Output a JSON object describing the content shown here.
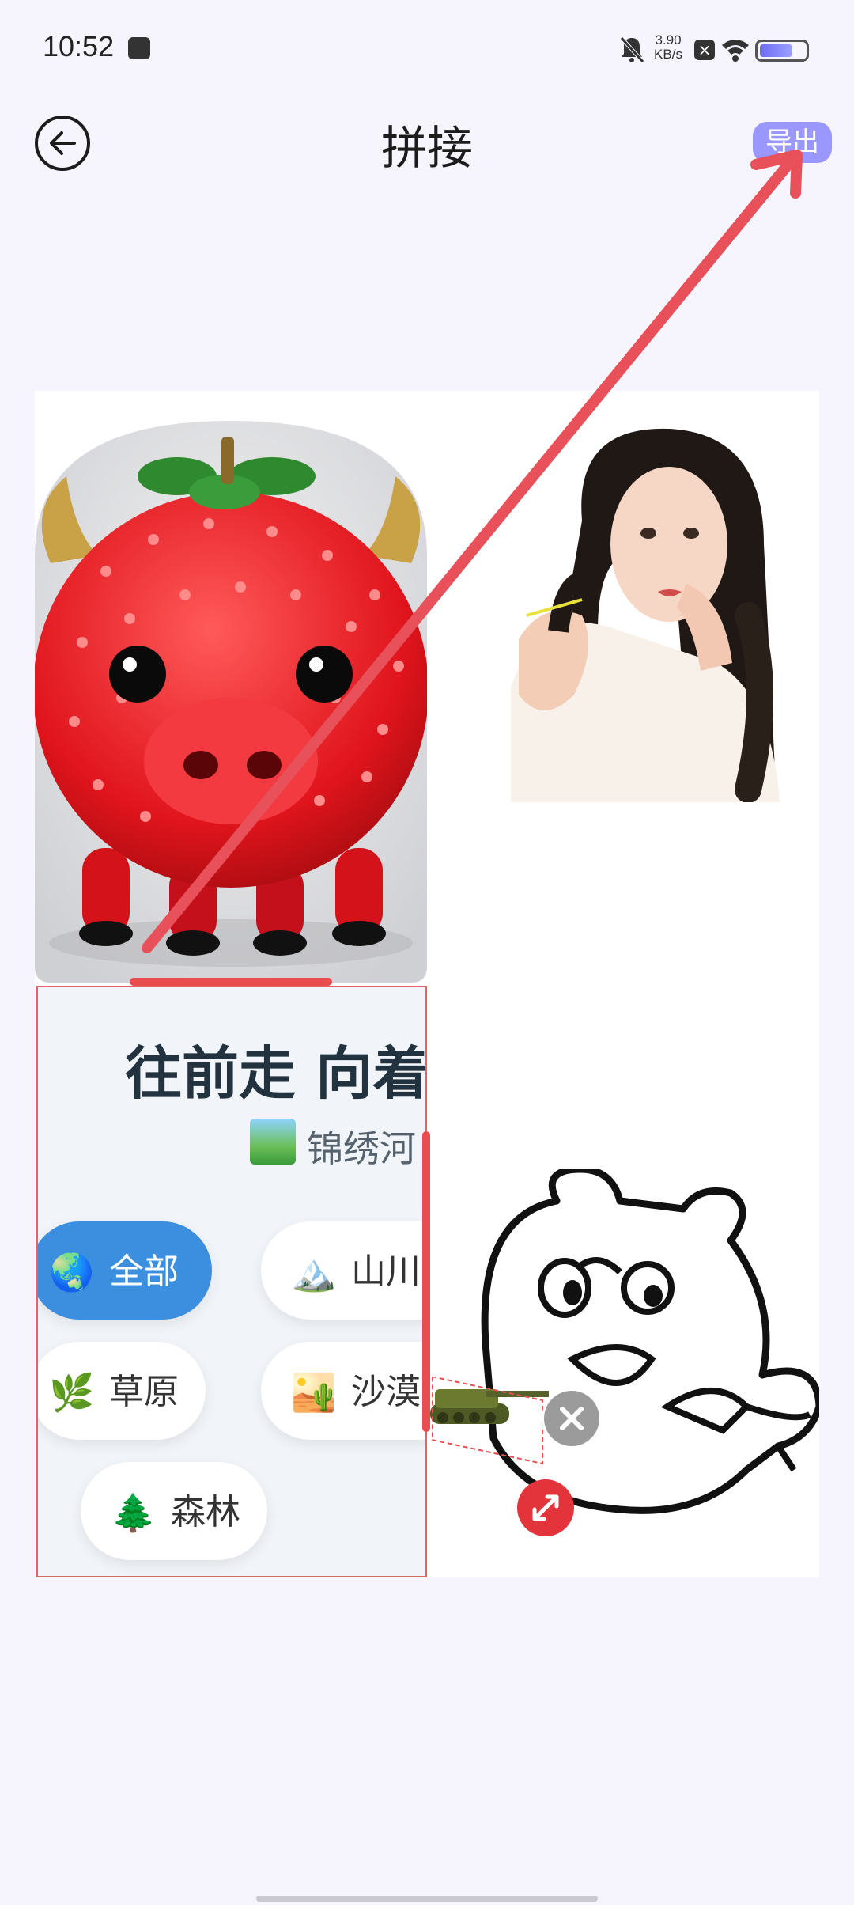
{
  "status_bar": {
    "time": "10:52",
    "net_speed_value": "3.90",
    "net_speed_unit": "KB/s",
    "battery_level": 0.75
  },
  "header": {
    "title": "拼接",
    "export_label": "导出"
  },
  "sticker": {
    "headline": "往前走 向着",
    "subtitle": "锦绣河",
    "chips": {
      "all": {
        "icon": "🌏",
        "label": "全部"
      },
      "mountain": {
        "icon": "🏔️",
        "label": "山川"
      },
      "grass": {
        "icon": "🌿",
        "label": "草原"
      },
      "desert": {
        "icon": "🏜️",
        "label": "沙漠"
      },
      "forest": {
        "icon": "🌲",
        "label": "森林"
      }
    }
  },
  "colors": {
    "background": "#f6f4fd",
    "accent": "#9a97ff",
    "selection": "#e84e4e",
    "chip_active": "#3b8fde"
  },
  "icons": [
    "back-arrow-icon",
    "bell-muted-icon",
    "wifi-icon",
    "battery-icon",
    "close-icon",
    "resize-icon"
  ]
}
